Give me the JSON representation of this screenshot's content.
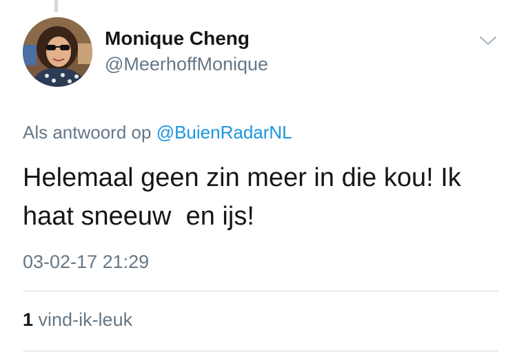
{
  "user": {
    "display_name": "Monique Cheng",
    "handle": "@MeerhoffMonique"
  },
  "reply": {
    "prefix": "Als antwoord op",
    "mention": "@BuienRadarNL"
  },
  "tweet": {
    "text": "Helemaal geen zin meer in die kou! Ik haat sneeuw  en ijs!",
    "timestamp": "03-02-17 21:29"
  },
  "stats": {
    "likes_count": "1",
    "likes_label": "vind-ik-leuk"
  },
  "colors": {
    "text": "#14171a",
    "muted": "#657786",
    "link": "#1b95e0",
    "divider": "#d6dbdf"
  },
  "icons": {
    "menu": "chevron-down-icon"
  }
}
